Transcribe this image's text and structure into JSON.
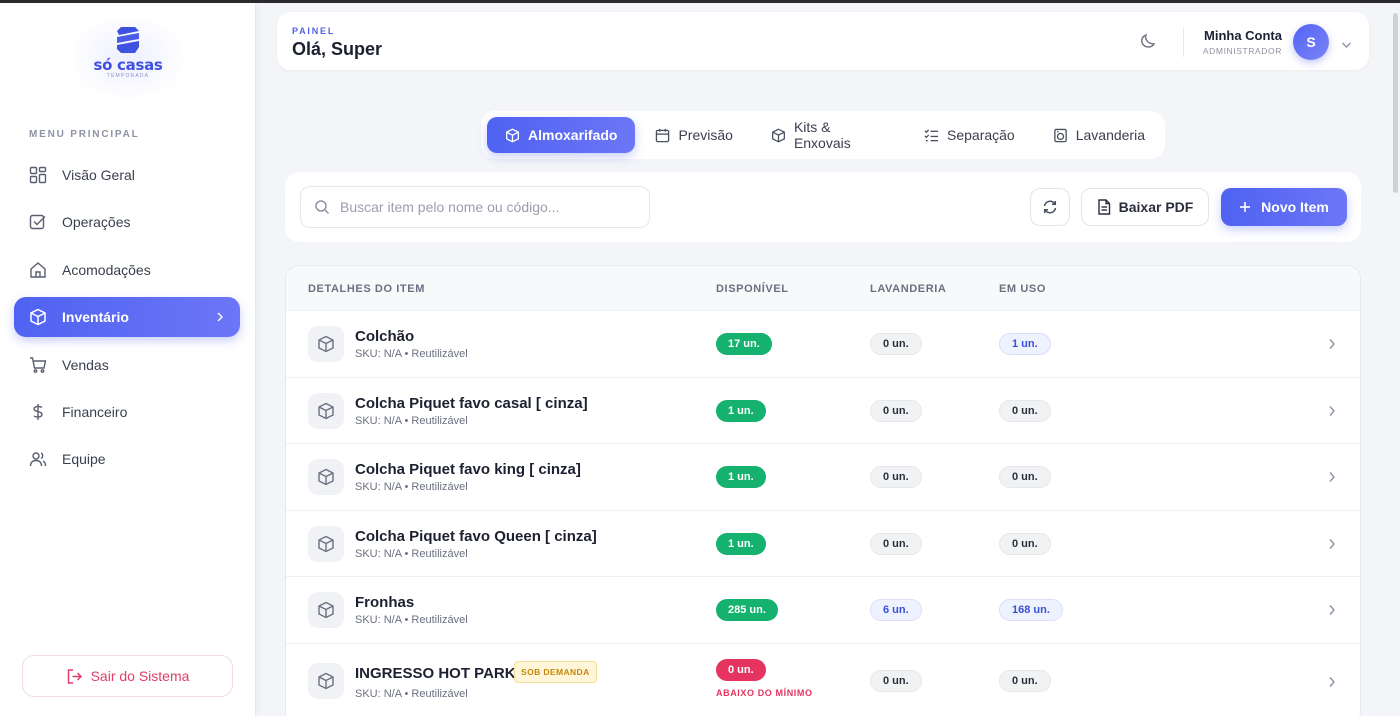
{
  "brand": {
    "name": "só casas",
    "sub": "TEMPORADA"
  },
  "sidebar": {
    "menu_title": "MENU PRINCIPAL",
    "items": [
      {
        "label": "Visão Geral",
        "icon": "grid-icon"
      },
      {
        "label": "Operações",
        "icon": "checkbox-icon"
      },
      {
        "label": "Acomodações",
        "icon": "home-icon"
      },
      {
        "label": "Inventário",
        "icon": "box-icon",
        "active": true
      },
      {
        "label": "Vendas",
        "icon": "cart-icon"
      },
      {
        "label": "Financeiro",
        "icon": "dollar-icon"
      },
      {
        "label": "Equipe",
        "icon": "users-icon"
      }
    ],
    "logout": "Sair do Sistema"
  },
  "header": {
    "kicker": "PAINEL",
    "title": "Olá, Super",
    "account_name": "Minha Conta",
    "account_role": "ADMINISTRADOR",
    "avatar_initial": "S"
  },
  "tabs": [
    {
      "label": "Almoxarifado",
      "active": true
    },
    {
      "label": "Previsão"
    },
    {
      "label": "Kits & Enxovais"
    },
    {
      "label": "Separação"
    },
    {
      "label": "Lavanderia"
    }
  ],
  "toolbar": {
    "search_placeholder": "Buscar item pelo nome ou código...",
    "pdf_label": "Baixar PDF",
    "new_label": "Novo Item"
  },
  "table": {
    "columns": [
      "DETALHES DO ITEM",
      "DISPONÍVEL",
      "LAVANDERIA",
      "EM USO"
    ],
    "rows": [
      {
        "name": "Colchão",
        "sku": "SKU: N/A • Reutilizável",
        "available": "17 un.",
        "laundry": "0 un.",
        "in_use": "1 un."
      },
      {
        "name": "Colcha Piquet favo casal [ cinza]",
        "sku": "SKU: N/A • Reutilizável",
        "available": "1 un.",
        "laundry": "0 un.",
        "in_use": "0 un."
      },
      {
        "name": "Colcha Piquet favo king [ cinza]",
        "sku": "SKU: N/A • Reutilizável",
        "available": "1 un.",
        "laundry": "0 un.",
        "in_use": "0 un."
      },
      {
        "name": "Colcha Piquet favo Queen [ cinza]",
        "sku": "SKU: N/A • Reutilizável",
        "available": "1 un.",
        "laundry": "0 un.",
        "in_use": "0 un."
      },
      {
        "name": "Fronhas",
        "sku": "SKU: N/A • Reutilizável",
        "available": "285 un.",
        "laundry": "6 un.",
        "in_use": "168 un."
      },
      {
        "name": "INGRESSO HOT PARK",
        "tag": "SOB DEMANDA",
        "sku": "SKU: N/A • Reutilizável",
        "available": "0 un.",
        "below_min": "ABAIXO DO MÍNIMO",
        "laundry": "0 un.",
        "in_use": "0 un."
      }
    ]
  },
  "colors": {
    "accent": "#4f62f1",
    "success": "#14b26e",
    "danger": "#e5345f"
  }
}
